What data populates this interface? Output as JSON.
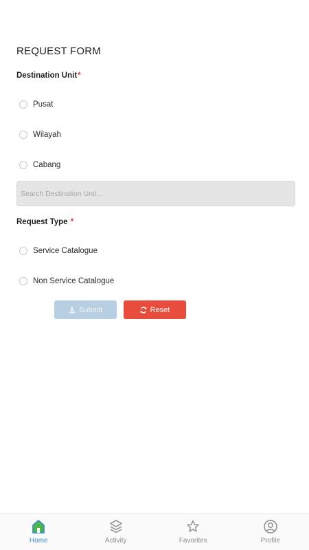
{
  "form": {
    "title": "REQUEST FORM",
    "destination": {
      "label": "Destination Unit",
      "required_mark": "*",
      "options": [
        "Pusat",
        "Wilayah",
        "Cabang"
      ],
      "search_placeholder": "Search Destination Unit..."
    },
    "request_type": {
      "label": "Request Type ",
      "required_mark": "*",
      "options": [
        "Service Catalogue",
        "Non Service Catalogue"
      ]
    },
    "buttons": {
      "submit_label": "Submit",
      "reset_label": "Reset"
    }
  },
  "bottom_nav": {
    "items": [
      {
        "label": "Home",
        "icon": "home-icon",
        "active": true
      },
      {
        "label": "Activity",
        "icon": "layers-icon",
        "active": false
      },
      {
        "label": "Favorites",
        "icon": "star-icon",
        "active": false
      },
      {
        "label": "Profile",
        "icon": "profile-icon",
        "active": false
      }
    ]
  },
  "colors": {
    "accent": "#3a8fd4",
    "required": "#e53935",
    "submit_bg": "#b7cee3",
    "reset_bg": "#e74c3c"
  }
}
